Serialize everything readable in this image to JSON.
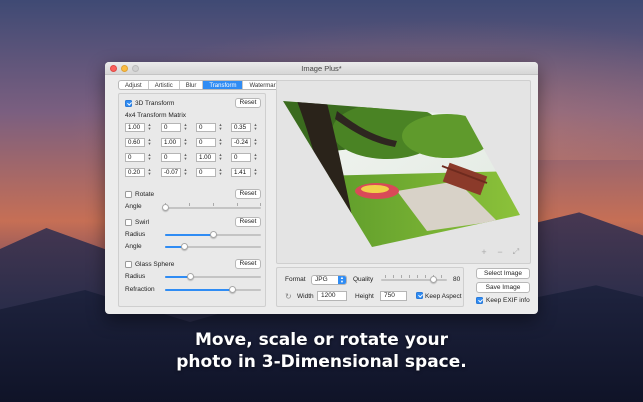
{
  "window": {
    "title": "Image Plus*"
  },
  "tabs": [
    {
      "label": "Adjust"
    },
    {
      "label": "Artistic"
    },
    {
      "label": "Blur"
    },
    {
      "label": "Transform",
      "active": true
    },
    {
      "label": "Watermark"
    }
  ],
  "transform3d": {
    "label": "3D Transform",
    "checked": true,
    "reset_label": "Reset",
    "matrix_title": "4x4 Transform Matrix",
    "matrix": [
      [
        "1.00",
        "0",
        "0",
        "0.35"
      ],
      [
        "0.60",
        "1.00",
        "0",
        "-0.24"
      ],
      [
        "0",
        "0",
        "1.00",
        "0"
      ],
      [
        "0.20",
        "-0.07",
        "0",
        "1.41"
      ]
    ]
  },
  "rotate": {
    "label": "Rotate",
    "checked": false,
    "reset_label": "Reset",
    "angle_label": "Angle",
    "angle_value": 0.0
  },
  "swirl": {
    "label": "Swirl",
    "checked": false,
    "reset_label": "Reset",
    "radius_label": "Radius",
    "radius_value": 0.5,
    "angle_label": "Angle",
    "angle_value": 0.2
  },
  "glass_sphere": {
    "label": "Glass Sphere",
    "checked": false,
    "reset_label": "Reset",
    "radius_label": "Radius",
    "radius_value": 0.27,
    "refraction_label": "Refraction",
    "refraction_value": 0.7
  },
  "output": {
    "format_label": "Format",
    "format_value": "JPG",
    "quality_label": "Quality",
    "quality_value": "80",
    "width_label": "Width",
    "width_value": "1200",
    "height_label": "Height",
    "height_value": "750",
    "keep_aspect_label": "Keep Aspect",
    "keep_aspect_checked": true
  },
  "actions": {
    "select_image": "Select Image",
    "save_image": "Save Image",
    "keep_exif_label": "Keep EXIF info",
    "keep_exif_checked": true
  },
  "caption": {
    "line1": "Move, scale or rotate your",
    "line2": "photo in 3-Dimensional space."
  },
  "colors": {
    "accent": "#2f8cf4"
  },
  "icons": {
    "zoom_in": "plus-icon",
    "zoom_out": "minus-icon",
    "fit": "expand-icon",
    "link": "link-icon"
  }
}
